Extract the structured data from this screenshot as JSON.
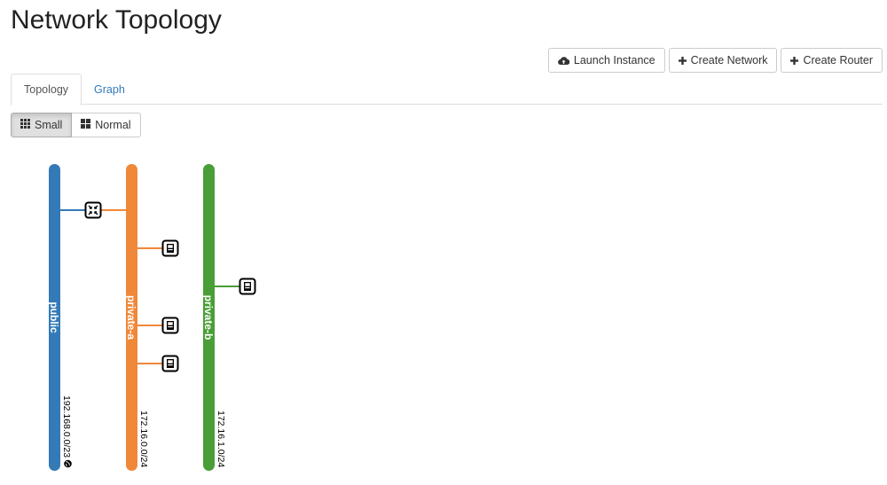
{
  "page": {
    "title": "Network Topology"
  },
  "actions": {
    "launch_instance": "Launch Instance",
    "create_network": "Create Network",
    "create_router": "Create Router"
  },
  "tabs": [
    {
      "label": "Topology",
      "active": true
    },
    {
      "label": "Graph",
      "active": false
    }
  ],
  "view_size": {
    "options": [
      {
        "label": "Small",
        "icon": "grid-small-icon",
        "active": true
      },
      {
        "label": "Normal",
        "icon": "grid-large-icon",
        "active": false
      }
    ]
  },
  "topology": {
    "networks": [
      {
        "name": "public",
        "cidr": "192.168.0.0/23",
        "color": "#337ab7",
        "external": true
      },
      {
        "name": "private-a",
        "cidr": "172.16.0.0/24",
        "color": "#f0883a",
        "external": false
      },
      {
        "name": "private-b",
        "cidr": "172.16.1.0/24",
        "color": "#4a9e37",
        "external": false
      }
    ],
    "devices": [
      {
        "type": "router",
        "icon": "router-icon",
        "connects": [
          "public",
          "private-a"
        ]
      },
      {
        "type": "instance",
        "icon": "instance-icon",
        "connects": [
          "private-a"
        ]
      },
      {
        "type": "instance",
        "icon": "instance-icon",
        "connects": [
          "private-b"
        ]
      },
      {
        "type": "instance",
        "icon": "instance-icon",
        "connects": [
          "private-a"
        ]
      },
      {
        "type": "instance",
        "icon": "instance-icon",
        "connects": [
          "private-a"
        ]
      }
    ]
  }
}
